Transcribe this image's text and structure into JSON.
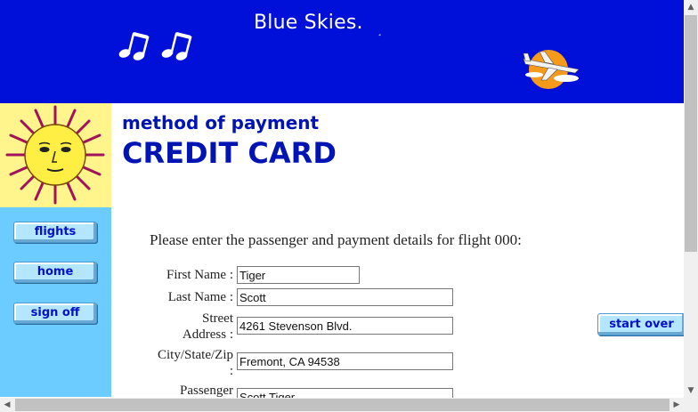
{
  "banner": {
    "brand": "Blue Skies.",
    "brand_tick": "¸",
    "color": "#0010d8"
  },
  "sidebar": {
    "color": "#6ccbff",
    "buttons": [
      "flights",
      "home",
      "sign off"
    ]
  },
  "page": {
    "subtitle": "method of payment",
    "title": "CREDIT CARD",
    "instruction": "Please enter the passenger and payment details for flight 000:",
    "title_color": "#0014b4"
  },
  "form": {
    "first_name": {
      "label": "First Name :",
      "value": "Tiger"
    },
    "last_name": {
      "label": "Last Name :",
      "value": "Scott"
    },
    "street": {
      "label_line1": "Street",
      "label_line2": "Address :",
      "value": "4261 Stevenson Blvd."
    },
    "city": {
      "label_line1": "City/State/Zip",
      "label_line2": ":",
      "value": "Fremont, CA 94538"
    },
    "passenger": {
      "label_line1": "Passenger",
      "value": "Scott Tiger"
    }
  },
  "actions": {
    "start_over": "start over"
  },
  "icons": {
    "notes": "music-notes-icon",
    "plane": "airplane-sun-icon",
    "sun": "sun-face-icon"
  }
}
